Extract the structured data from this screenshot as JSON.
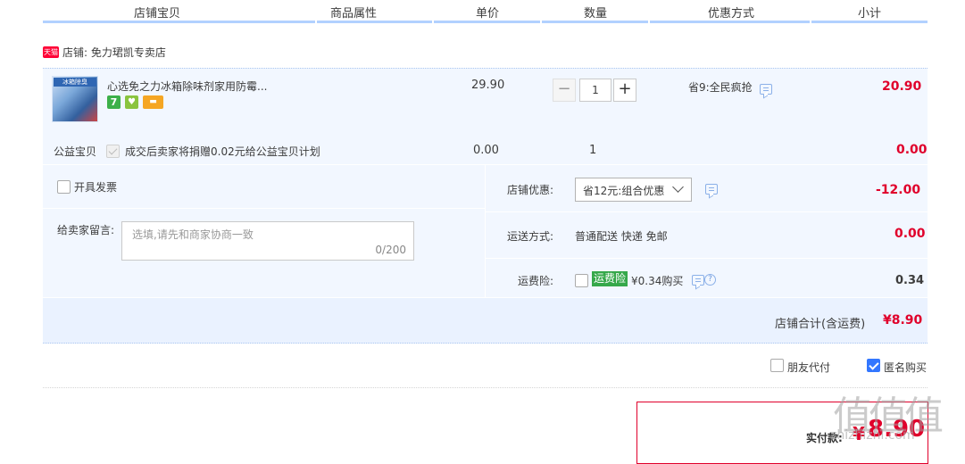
{
  "header": {
    "cols": [
      "店铺宝贝",
      "商品属性",
      "单价",
      "数量",
      "优惠方式",
      "小计"
    ]
  },
  "shop": {
    "logo_text": "天猫",
    "name": "店铺: 免力珺凯专卖店"
  },
  "item": {
    "thumb_text": "冰箱除臭",
    "title": "心选免之力冰箱除味剂家用防霉...",
    "price": "29.90",
    "qty_minus": "−",
    "qty": "1",
    "qty_plus": "+",
    "discount": "省9:全民疯抢",
    "subtotal": "20.90",
    "badges": [
      "7",
      "♥",
      "▬"
    ]
  },
  "charity": {
    "label": "公益宝贝",
    "text": "成交后卖家将捐赠0.02元给公益宝贝计划",
    "price": "0.00",
    "qty": "1",
    "subtotal": "0.00"
  },
  "invoice": {
    "label": "开具发票"
  },
  "message": {
    "label": "给卖家留言:",
    "placeholder": "选填,请先和商家协商一致",
    "counter": "0/200"
  },
  "shop_discount": {
    "label": "店铺优惠:",
    "selected": "省12元:组合优惠",
    "amount": "-12.00"
  },
  "delivery": {
    "label": "运送方式:",
    "value": "普通配送 快递 免邮",
    "amount": "0.00"
  },
  "insurance": {
    "label": "运费险:",
    "tag": "运费险",
    "price": "¥0.34购买",
    "help": "?",
    "amount": "0.34"
  },
  "shop_total": {
    "label": "店铺合计(含运费)",
    "amount": "¥8.90"
  },
  "options": {
    "friend_pay": "朋友代付",
    "anonymous": "匿名购买"
  },
  "pay": {
    "label": "实付款:",
    "currency": "¥",
    "amount": "8.90"
  },
  "watermark": {
    "text": "值值值",
    "url": "zhizhizhi.com"
  }
}
